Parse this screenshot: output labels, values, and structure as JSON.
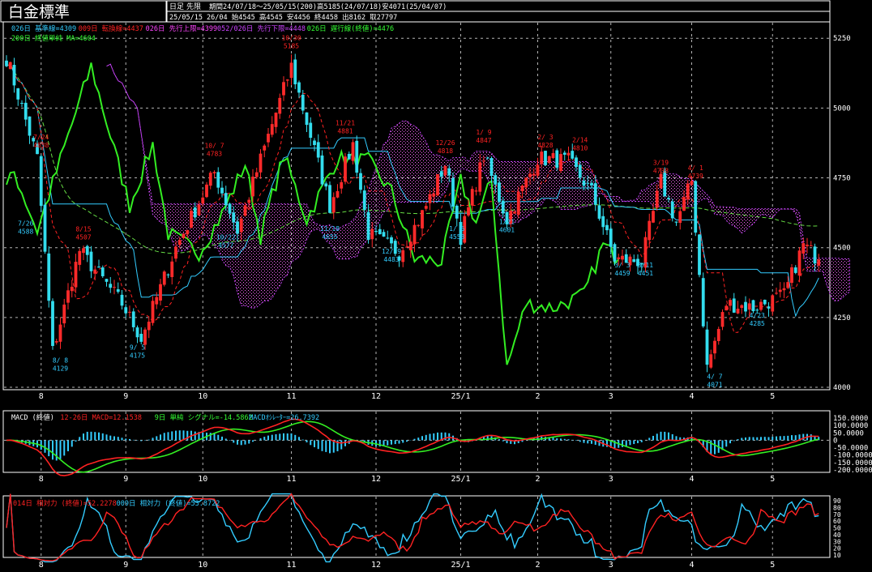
{
  "header": {
    "title": "白金標準",
    "period_label": "日足",
    "contract": "先限",
    "summary": "期間24/07/18～25/05/15(200)高5185(24/07/18)安4071(25/04/07)",
    "last_bar": "25/05/15 26/04 始4545 高4545 安4456 終4458 出8162 取27797"
  },
  "legend_main": [
    {
      "text": "026日 基準線=4309",
      "color": "#33ccff"
    },
    {
      "text": "009日 転換線=4437",
      "color": "#ff2222"
    },
    {
      "text": "026日 先行上限=4399",
      "color": "#ff44ff"
    },
    {
      "text": "052/026日 先行下限=4448",
      "color": "#cc44ff"
    },
    {
      "text": "026日 遅行線(終値)=4476",
      "color": "#33ff33"
    },
    {
      "text": "200日 終値単純 MA=4604",
      "color": "#33ff33"
    }
  ],
  "legend_macd": [
    {
      "text": "MACD (終値)",
      "color": "#ffffff"
    },
    {
      "text": "12-26日 MACD=12.1538",
      "color": "#ff2222"
    },
    {
      "text": "9日 単純 シグナル=-14.5862",
      "color": "#33ff33"
    },
    {
      "text": "MACDｵｼﾚｰﾀｰ=26.7392",
      "color": "#33ccff"
    }
  ],
  "legend_rsi": [
    {
      "text": "014日 相対力 (終値)=52.2278",
      "color": "#ff2222"
    },
    {
      "text": "009日 相対力 (終値)=53.8722",
      "color": "#33ccff"
    }
  ],
  "chart_data": {
    "type": "candlestick",
    "price_axis": {
      "ticks": [
        "5250",
        "5000",
        "4750",
        "4500",
        "4250",
        "4000"
      ],
      "ylim": [
        4000,
        5300
      ]
    },
    "macd_axis": {
      "ticks": [
        "150.0000",
        "100.0000",
        "50.0000",
        "0",
        "-50.0000",
        "-100.0000",
        "-150.0000",
        "-200.0000"
      ],
      "ylim": [
        -200,
        150
      ]
    },
    "rsi_axis": {
      "ticks": [
        "90",
        "80",
        "70",
        "60",
        "50",
        "40",
        "30",
        "20",
        "10"
      ],
      "ylim": [
        10,
        90
      ]
    },
    "x_ticks": [
      "8",
      "9",
      "10",
      "11",
      "12",
      "25/1",
      "2",
      "3",
      "4",
      "5"
    ],
    "x_tick_bars": [
      9,
      31,
      51,
      74,
      96,
      118,
      138,
      157,
      178,
      199
    ],
    "num_bars": 212,
    "anchors": [
      {
        "bar": 0,
        "price": 5185
      },
      {
        "bar": 8,
        "price": 4820
      },
      {
        "bar": 12,
        "price": 4129
      },
      {
        "bar": 19,
        "price": 4490
      },
      {
        "bar": 30,
        "price": 4300
      },
      {
        "bar": 35,
        "price": 4175
      },
      {
        "bar": 44,
        "price": 4500
      },
      {
        "bar": 54,
        "price": 4770
      },
      {
        "bar": 60,
        "price": 4560
      },
      {
        "bar": 68,
        "price": 4900
      },
      {
        "bar": 74,
        "price": 5150
      },
      {
        "bar": 80,
        "price": 4850
      },
      {
        "bar": 84,
        "price": 4650
      },
      {
        "bar": 90,
        "price": 4870
      },
      {
        "bar": 94,
        "price": 4550
      },
      {
        "bar": 102,
        "price": 4483
      },
      {
        "bar": 108,
        "price": 4620
      },
      {
        "bar": 114,
        "price": 4800
      },
      {
        "bar": 118,
        "price": 4540
      },
      {
        "bar": 124,
        "price": 4830
      },
      {
        "bar": 130,
        "price": 4601
      },
      {
        "bar": 138,
        "price": 4820
      },
      {
        "bar": 146,
        "price": 4810
      },
      {
        "bar": 152,
        "price": 4700
      },
      {
        "bar": 158,
        "price": 4459
      },
      {
        "bar": 165,
        "price": 4451
      },
      {
        "bar": 170,
        "price": 4739
      },
      {
        "bar": 174,
        "price": 4590
      },
      {
        "bar": 178,
        "price": 4740
      },
      {
        "bar": 182,
        "price": 4071
      },
      {
        "bar": 187,
        "price": 4300
      },
      {
        "bar": 194,
        "price": 4285
      },
      {
        "bar": 202,
        "price": 4330
      },
      {
        "bar": 207,
        "price": 4510
      },
      {
        "bar": 211,
        "price": 4458
      }
    ],
    "annotations": [
      {
        "bar": 9,
        "price": 4830,
        "date": "7/24",
        "value": "4838",
        "color": "#ff2222",
        "pos": "above"
      },
      {
        "bar": 5,
        "price": 4620,
        "date": "7/26",
        "value": "4588",
        "color": "#33ccff",
        "pos": "below"
      },
      {
        "bar": 14,
        "price": 4129,
        "date": "8/ 8",
        "value": "4129",
        "color": "#33ccff",
        "pos": "below"
      },
      {
        "bar": 20,
        "price": 4500,
        "date": "8/15",
        "value": "4507",
        "color": "#ff2222",
        "pos": "above"
      },
      {
        "bar": 34,
        "price": 4175,
        "date": "9/ 5",
        "value": "4175",
        "color": "#33ccff",
        "pos": "below"
      },
      {
        "bar": 54,
        "price": 4800,
        "date": "10/ 7",
        "value": "4783",
        "color": "#ff2222",
        "pos": "above"
      },
      {
        "bar": 57,
        "price": 4570,
        "date": "10/22",
        "value": "4577",
        "color": "#33ccff",
        "pos": "below"
      },
      {
        "bar": 74,
        "price": 5185,
        "date": "10/30",
        "value": "5185",
        "color": "#ff2222",
        "pos": "above"
      },
      {
        "bar": 84,
        "price": 4600,
        "date": "11/18",
        "value": "4655",
        "color": "#33ccff",
        "pos": "below"
      },
      {
        "bar": 88,
        "price": 4881,
        "date": "11/21",
        "value": "4881",
        "color": "#ff2222",
        "pos": "above"
      },
      {
        "bar": 100,
        "price": 4520,
        "date": "12/ 9",
        "value": "4483",
        "color": "#33ccff",
        "pos": "below"
      },
      {
        "bar": 114,
        "price": 4810,
        "date": "12/26",
        "value": "4818",
        "color": "#ff2222",
        "pos": "above"
      },
      {
        "bar": 117,
        "price": 4600,
        "date": "1/ 6",
        "value": "4558",
        "color": "#33ccff",
        "pos": "below"
      },
      {
        "bar": 124,
        "price": 4847,
        "date": "1/ 9",
        "value": "4847",
        "color": "#ff2222",
        "pos": "above"
      },
      {
        "bar": 130,
        "price": 4625,
        "date": "1/21",
        "value": "4601",
        "color": "#33ccff",
        "pos": "below"
      },
      {
        "bar": 140,
        "price": 4830,
        "date": "2/ 3",
        "value": "4828",
        "color": "#ff2222",
        "pos": "above"
      },
      {
        "bar": 149,
        "price": 4820,
        "date": "2/14",
        "value": "4810",
        "color": "#ff2222",
        "pos": "above"
      },
      {
        "bar": 160,
        "price": 4470,
        "date": "3/ 3",
        "value": "4459",
        "color": "#33ccff",
        "pos": "below"
      },
      {
        "bar": 166,
        "price": 4470,
        "date": "3/11",
        "value": "4451",
        "color": "#33ccff",
        "pos": "below"
      },
      {
        "bar": 170,
        "price": 4739,
        "date": "3/19",
        "value": "4738",
        "color": "#ff2222",
        "pos": "above"
      },
      {
        "bar": 179,
        "price": 4720,
        "date": "4/ 1",
        "value": "4739",
        "color": "#ff2222",
        "pos": "above"
      },
      {
        "bar": 184,
        "price": 4071,
        "date": "4/ 7",
        "value": "4071",
        "color": "#33ccff",
        "pos": "below"
      },
      {
        "bar": 195,
        "price": 4290,
        "date": "4/23",
        "value": "4285",
        "color": "#33ccff",
        "pos": "below"
      }
    ]
  }
}
